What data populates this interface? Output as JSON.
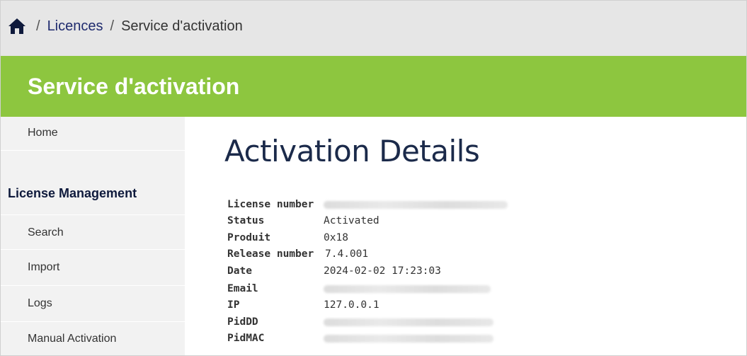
{
  "breadcrumb": {
    "home_icon": "home-icon",
    "separator": "/",
    "items": [
      "Licences",
      "Service d'activation"
    ]
  },
  "header": {
    "title": "Service d'activation"
  },
  "sidebar": {
    "home": "Home",
    "section_title": "License Management",
    "items": [
      "Search",
      "Import",
      "Logs",
      "Manual Activation"
    ]
  },
  "main": {
    "title": "Activation Details",
    "details": [
      {
        "label": "License number",
        "value": ""
      },
      {
        "label": "Status",
        "value": "Activated"
      },
      {
        "label": "Produit",
        "value": "0x18"
      },
      {
        "label": "Release number",
        "value": "7.4.001"
      },
      {
        "label": "Date",
        "value": "2024-02-02 17:23:03"
      },
      {
        "label": "Email",
        "value": ""
      },
      {
        "label": "IP",
        "value": "127.0.0.1"
      },
      {
        "label": "PidDD",
        "value": ""
      },
      {
        "label": "PidMAC",
        "value": ""
      }
    ]
  },
  "colors": {
    "accent": "#8dc63f",
    "breadcrumb_bg": "#e6e6e6",
    "sidebar_bg": "#f2f2f2",
    "link": "#1f2b6e"
  }
}
